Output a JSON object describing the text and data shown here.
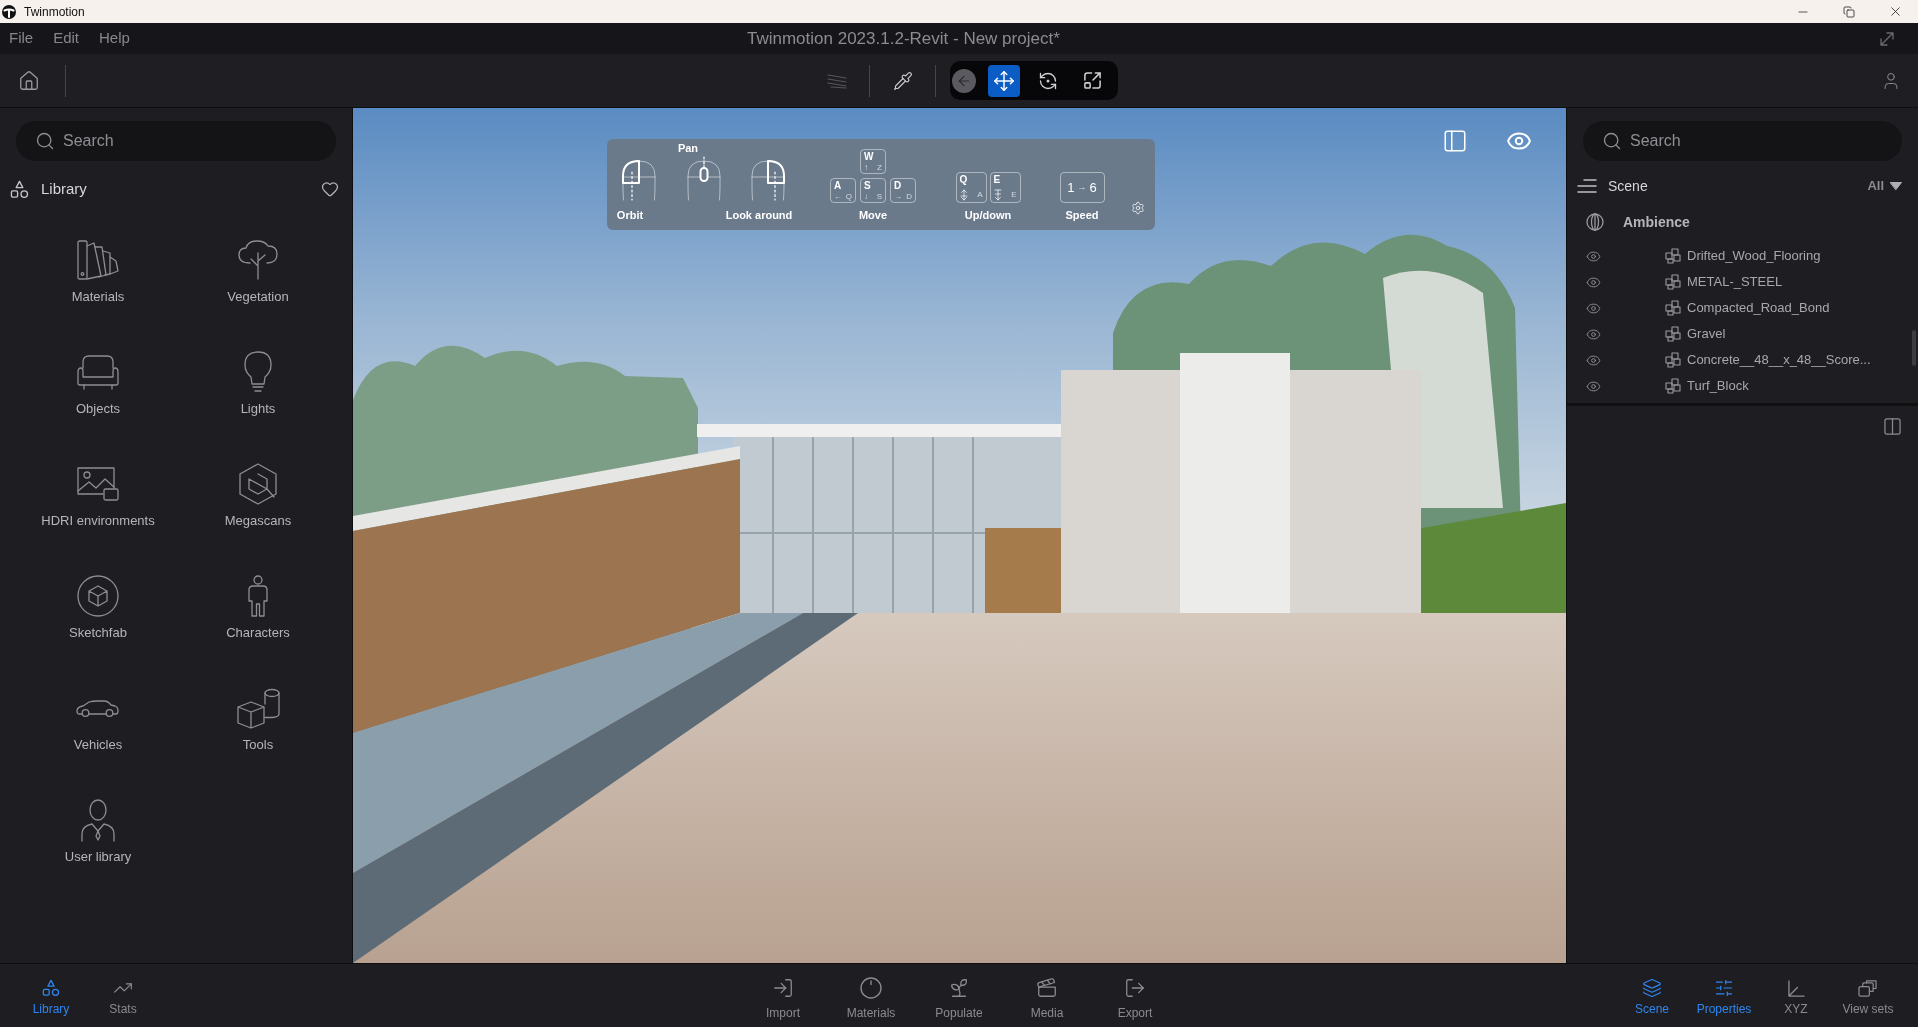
{
  "window": {
    "title": "Twinmotion"
  },
  "menu_bar": {
    "items": [
      "File",
      "Edit",
      "Help"
    ],
    "title": "Twinmotion 2023.1.2-Revit - New project*"
  },
  "toolbar": {
    "tools": [
      {
        "kind": "hatch",
        "disabled": true
      },
      {
        "kind": "eyedropper",
        "disabled": false
      }
    ],
    "nav_tools": [
      {
        "kind": "back",
        "disabled": true,
        "selected": false
      },
      {
        "kind": "move",
        "disabled": false,
        "selected": true
      },
      {
        "kind": "orbit",
        "disabled": false,
        "selected": false
      },
      {
        "kind": "fit",
        "disabled": false,
        "selected": false
      }
    ]
  },
  "library": {
    "search": {
      "placeholder": "Search"
    },
    "title": "Library",
    "categories": [
      {
        "kind": "materials",
        "label": "Materials"
      },
      {
        "kind": "vegetation",
        "label": "Vegetation"
      },
      {
        "kind": "objects",
        "label": "Objects"
      },
      {
        "kind": "lights",
        "label": "Lights"
      },
      {
        "kind": "hdri",
        "label": "HDRI environments"
      },
      {
        "kind": "megascans",
        "label": "Megascans"
      },
      {
        "kind": "sketchfab",
        "label": "Sketchfab"
      },
      {
        "kind": "characters",
        "label": "Characters"
      },
      {
        "kind": "vehicles",
        "label": "Vehicles"
      },
      {
        "kind": "tools",
        "label": "Tools"
      },
      {
        "kind": "user_library",
        "label": "User library"
      }
    ]
  },
  "viewport": {
    "navigation_help": {
      "mouse": [
        {
          "kind": "orbit",
          "label": "Orbit"
        },
        {
          "kind": "pan",
          "label": "Pan"
        },
        {
          "kind": "look",
          "label": "Look around"
        }
      ],
      "move": {
        "label": "Move",
        "keys": [
          {
            "key": "W",
            "arrow": "↑",
            "alt": "Z"
          },
          {
            "key": "A",
            "arrow": "←",
            "alt": "Q"
          },
          {
            "key": "S",
            "arrow": "↓",
            "alt": "S"
          },
          {
            "key": "D",
            "arrow": "→",
            "alt": "D"
          }
        ]
      },
      "up_down": {
        "label": "Up/down",
        "keys": [
          {
            "key": "Q",
            "kind": "up",
            "alt": "A"
          },
          {
            "key": "E",
            "kind": "down",
            "alt": "E"
          }
        ]
      },
      "speed": {
        "label": "Speed",
        "from": "1",
        "arrow": "→",
        "to": "6"
      }
    }
  },
  "scene": {
    "search": {
      "placeholder": "Search"
    },
    "title": "Scene",
    "filter": "All",
    "tree": [
      {
        "label": "Ambience",
        "children": [
          {
            "label": "Drifted_Wood_Flooring",
            "visible": true
          },
          {
            "label": "METAL-_STEEL",
            "visible": true
          },
          {
            "label": "Compacted_Road_Bond",
            "visible": true
          },
          {
            "label": "Gravel",
            "visible": true
          },
          {
            "label": "Concrete__48__x_48__Score...",
            "visible": true
          },
          {
            "label": "Turf_Block",
            "visible": true
          }
        ]
      }
    ]
  },
  "bottom_bar": {
    "left": [
      {
        "kind": "library",
        "label": "Library",
        "selected": true
      },
      {
        "kind": "stats",
        "label": "Stats",
        "selected": false
      }
    ],
    "center": [
      {
        "kind": "import",
        "label": "Import"
      },
      {
        "kind": "materials",
        "label": "Materials"
      },
      {
        "kind": "populate",
        "label": "Populate"
      },
      {
        "kind": "media",
        "label": "Media"
      },
      {
        "kind": "export",
        "label": "Export"
      }
    ],
    "right": [
      {
        "kind": "scene",
        "label": "Scene",
        "selected": true
      },
      {
        "kind": "properties",
        "label": "Properties",
        "selected": true
      },
      {
        "kind": "xyz",
        "label": "XYZ",
        "selected": false
      },
      {
        "kind": "view_sets",
        "label": "View sets",
        "selected": false
      }
    ]
  }
}
